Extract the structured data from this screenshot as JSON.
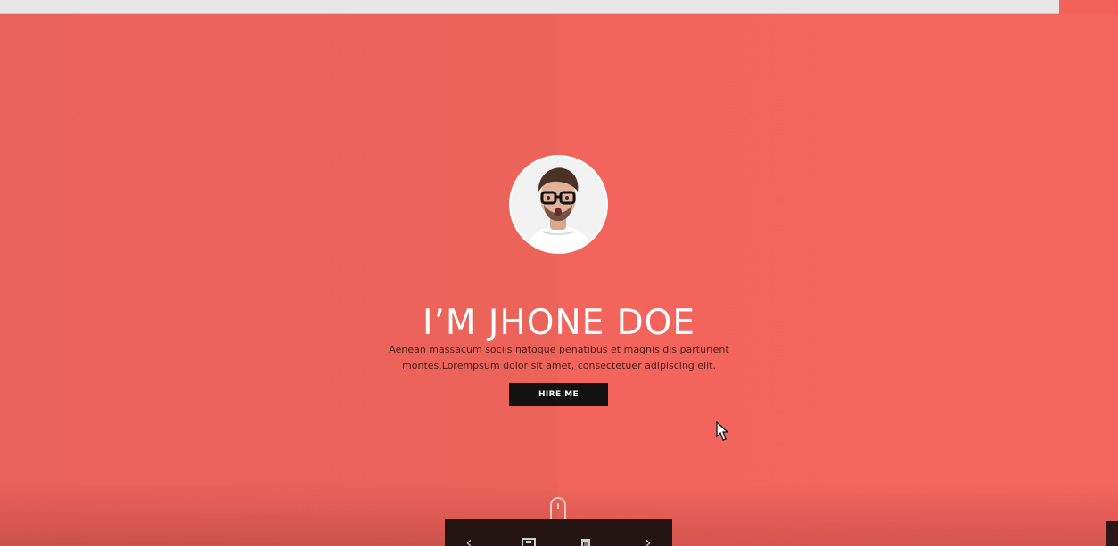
{
  "hero": {
    "title": "I’M JHONE DOE",
    "description": "Aenean massacum sociis natoque penatibus et magnis dis parturient montes.Lorempsum dolor sit amet, consectetuer adipiscing elit.",
    "button_label": "HIRE ME"
  },
  "icons": {
    "avatar": "person-portrait",
    "scroll": "mouse-scroll-icon",
    "player_prev": "chevron-left-icon",
    "player_save": "save-icon",
    "player_delete": "trash-icon",
    "player_next": "chevron-right-icon",
    "cursor": "mouse-pointer-icon"
  },
  "colors": {
    "accent": "#ef6158",
    "button_bg": "#141111",
    "title_text": "#ffffff",
    "body_text": "#4a1d1b"
  }
}
